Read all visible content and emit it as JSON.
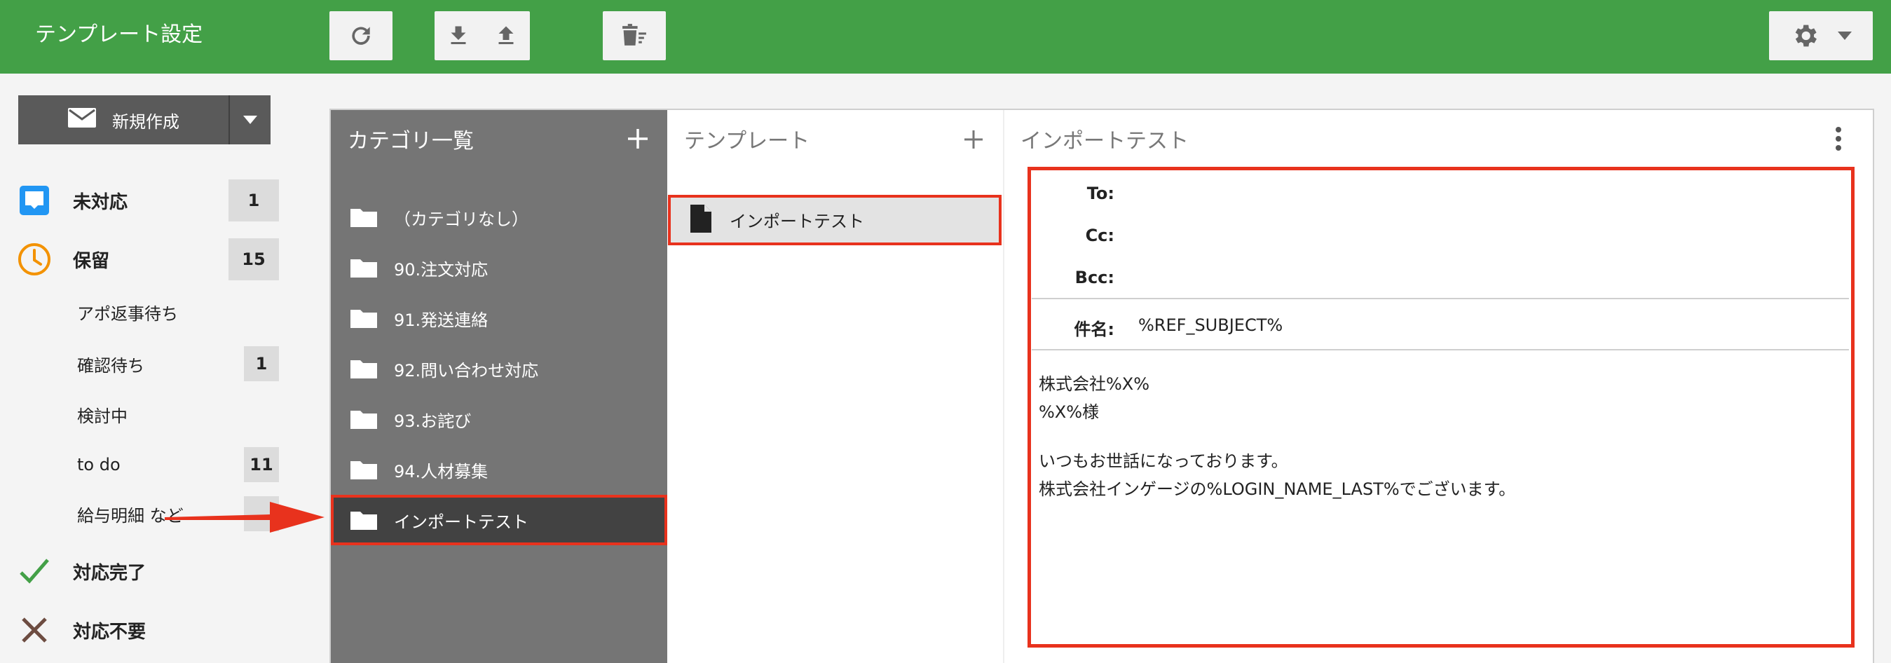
{
  "header": {
    "title": "テンプレート設定",
    "bg_color": "#43a047",
    "toolbar": {
      "refresh_icon": "refresh-icon",
      "download_icon": "download-icon",
      "upload_icon": "upload-icon",
      "delete_icon": "delete-icon",
      "settings_icon": "gear-icon"
    }
  },
  "sidebar": {
    "compose_label": "新規作成",
    "statuses": [
      {
        "label": "未対応",
        "count": "1",
        "icon": "inbox-icon"
      },
      {
        "label": "保留",
        "count": "15",
        "icon": "clock-icon"
      }
    ],
    "subfolders": [
      {
        "label": "アポ返事待ち",
        "count": ""
      },
      {
        "label": "確認待ち",
        "count": "1"
      },
      {
        "label": "検討中",
        "count": ""
      },
      {
        "label": "to do",
        "count": "11"
      },
      {
        "label": "給与明細 など",
        "count": ""
      }
    ],
    "done": {
      "label": "対応完了",
      "icon": "check-icon"
    },
    "unneeded": {
      "label": "対応不要",
      "icon": "x-icon"
    }
  },
  "categories": {
    "title": "カテゴリ一覧",
    "items": [
      {
        "label": "（カテゴリなし）"
      },
      {
        "label": "90.注文対応"
      },
      {
        "label": "91.発送連絡"
      },
      {
        "label": "92.問い合わせ対応"
      },
      {
        "label": "93.お詫び"
      },
      {
        "label": "94.人材募集"
      },
      {
        "label": "インポートテスト",
        "selected": true
      }
    ]
  },
  "templates": {
    "title": "テンプレート",
    "items": [
      {
        "label": "インポートテスト",
        "selected": true
      }
    ]
  },
  "detail": {
    "title": "インポートテスト",
    "to_label": "To:",
    "cc_label": "Cc:",
    "bcc_label": "Bcc:",
    "subject_label": "件名:",
    "subject_value": "%REF_SUBJECT%",
    "body": [
      "株式会社%X%",
      "%X%様",
      "",
      "いつもお世話になっております。",
      "株式会社インゲージの%LOGIN_NAME_LAST%でございます。"
    ]
  },
  "highlight_color": "#e8321d"
}
